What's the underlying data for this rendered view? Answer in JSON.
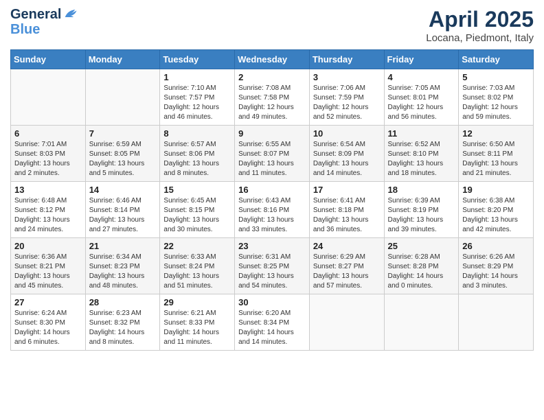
{
  "header": {
    "logo_line1": "General",
    "logo_line2": "Blue",
    "title": "April 2025",
    "subtitle": "Locana, Piedmont, Italy"
  },
  "calendar": {
    "days_of_week": [
      "Sunday",
      "Monday",
      "Tuesday",
      "Wednesday",
      "Thursday",
      "Friday",
      "Saturday"
    ],
    "weeks": [
      [
        {
          "day": "",
          "sunrise": "",
          "sunset": "",
          "daylight": ""
        },
        {
          "day": "",
          "sunrise": "",
          "sunset": "",
          "daylight": ""
        },
        {
          "day": "1",
          "sunrise": "Sunrise: 7:10 AM",
          "sunset": "Sunset: 7:57 PM",
          "daylight": "Daylight: 12 hours and 46 minutes."
        },
        {
          "day": "2",
          "sunrise": "Sunrise: 7:08 AM",
          "sunset": "Sunset: 7:58 PM",
          "daylight": "Daylight: 12 hours and 49 minutes."
        },
        {
          "day": "3",
          "sunrise": "Sunrise: 7:06 AM",
          "sunset": "Sunset: 7:59 PM",
          "daylight": "Daylight: 12 hours and 52 minutes."
        },
        {
          "day": "4",
          "sunrise": "Sunrise: 7:05 AM",
          "sunset": "Sunset: 8:01 PM",
          "daylight": "Daylight: 12 hours and 56 minutes."
        },
        {
          "day": "5",
          "sunrise": "Sunrise: 7:03 AM",
          "sunset": "Sunset: 8:02 PM",
          "daylight": "Daylight: 12 hours and 59 minutes."
        }
      ],
      [
        {
          "day": "6",
          "sunrise": "Sunrise: 7:01 AM",
          "sunset": "Sunset: 8:03 PM",
          "daylight": "Daylight: 13 hours and 2 minutes."
        },
        {
          "day": "7",
          "sunrise": "Sunrise: 6:59 AM",
          "sunset": "Sunset: 8:05 PM",
          "daylight": "Daylight: 13 hours and 5 minutes."
        },
        {
          "day": "8",
          "sunrise": "Sunrise: 6:57 AM",
          "sunset": "Sunset: 8:06 PM",
          "daylight": "Daylight: 13 hours and 8 minutes."
        },
        {
          "day": "9",
          "sunrise": "Sunrise: 6:55 AM",
          "sunset": "Sunset: 8:07 PM",
          "daylight": "Daylight: 13 hours and 11 minutes."
        },
        {
          "day": "10",
          "sunrise": "Sunrise: 6:54 AM",
          "sunset": "Sunset: 8:09 PM",
          "daylight": "Daylight: 13 hours and 14 minutes."
        },
        {
          "day": "11",
          "sunrise": "Sunrise: 6:52 AM",
          "sunset": "Sunset: 8:10 PM",
          "daylight": "Daylight: 13 hours and 18 minutes."
        },
        {
          "day": "12",
          "sunrise": "Sunrise: 6:50 AM",
          "sunset": "Sunset: 8:11 PM",
          "daylight": "Daylight: 13 hours and 21 minutes."
        }
      ],
      [
        {
          "day": "13",
          "sunrise": "Sunrise: 6:48 AM",
          "sunset": "Sunset: 8:12 PM",
          "daylight": "Daylight: 13 hours and 24 minutes."
        },
        {
          "day": "14",
          "sunrise": "Sunrise: 6:46 AM",
          "sunset": "Sunset: 8:14 PM",
          "daylight": "Daylight: 13 hours and 27 minutes."
        },
        {
          "day": "15",
          "sunrise": "Sunrise: 6:45 AM",
          "sunset": "Sunset: 8:15 PM",
          "daylight": "Daylight: 13 hours and 30 minutes."
        },
        {
          "day": "16",
          "sunrise": "Sunrise: 6:43 AM",
          "sunset": "Sunset: 8:16 PM",
          "daylight": "Daylight: 13 hours and 33 minutes."
        },
        {
          "day": "17",
          "sunrise": "Sunrise: 6:41 AM",
          "sunset": "Sunset: 8:18 PM",
          "daylight": "Daylight: 13 hours and 36 minutes."
        },
        {
          "day": "18",
          "sunrise": "Sunrise: 6:39 AM",
          "sunset": "Sunset: 8:19 PM",
          "daylight": "Daylight: 13 hours and 39 minutes."
        },
        {
          "day": "19",
          "sunrise": "Sunrise: 6:38 AM",
          "sunset": "Sunset: 8:20 PM",
          "daylight": "Daylight: 13 hours and 42 minutes."
        }
      ],
      [
        {
          "day": "20",
          "sunrise": "Sunrise: 6:36 AM",
          "sunset": "Sunset: 8:21 PM",
          "daylight": "Daylight: 13 hours and 45 minutes."
        },
        {
          "day": "21",
          "sunrise": "Sunrise: 6:34 AM",
          "sunset": "Sunset: 8:23 PM",
          "daylight": "Daylight: 13 hours and 48 minutes."
        },
        {
          "day": "22",
          "sunrise": "Sunrise: 6:33 AM",
          "sunset": "Sunset: 8:24 PM",
          "daylight": "Daylight: 13 hours and 51 minutes."
        },
        {
          "day": "23",
          "sunrise": "Sunrise: 6:31 AM",
          "sunset": "Sunset: 8:25 PM",
          "daylight": "Daylight: 13 hours and 54 minutes."
        },
        {
          "day": "24",
          "sunrise": "Sunrise: 6:29 AM",
          "sunset": "Sunset: 8:27 PM",
          "daylight": "Daylight: 13 hours and 57 minutes."
        },
        {
          "day": "25",
          "sunrise": "Sunrise: 6:28 AM",
          "sunset": "Sunset: 8:28 PM",
          "daylight": "Daylight: 14 hours and 0 minutes."
        },
        {
          "day": "26",
          "sunrise": "Sunrise: 6:26 AM",
          "sunset": "Sunset: 8:29 PM",
          "daylight": "Daylight: 14 hours and 3 minutes."
        }
      ],
      [
        {
          "day": "27",
          "sunrise": "Sunrise: 6:24 AM",
          "sunset": "Sunset: 8:30 PM",
          "daylight": "Daylight: 14 hours and 6 minutes."
        },
        {
          "day": "28",
          "sunrise": "Sunrise: 6:23 AM",
          "sunset": "Sunset: 8:32 PM",
          "daylight": "Daylight: 14 hours and 8 minutes."
        },
        {
          "day": "29",
          "sunrise": "Sunrise: 6:21 AM",
          "sunset": "Sunset: 8:33 PM",
          "daylight": "Daylight: 14 hours and 11 minutes."
        },
        {
          "day": "30",
          "sunrise": "Sunrise: 6:20 AM",
          "sunset": "Sunset: 8:34 PM",
          "daylight": "Daylight: 14 hours and 14 minutes."
        },
        {
          "day": "",
          "sunrise": "",
          "sunset": "",
          "daylight": ""
        },
        {
          "day": "",
          "sunrise": "",
          "sunset": "",
          "daylight": ""
        },
        {
          "day": "",
          "sunrise": "",
          "sunset": "",
          "daylight": ""
        }
      ]
    ]
  }
}
